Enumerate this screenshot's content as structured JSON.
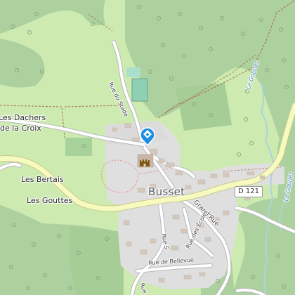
{
  "map": {
    "places": {
      "les_dachers": "Les Dachers",
      "de_la_croix": "de la Croix",
      "les_bertais": "Les Bertais",
      "les_gouttes": "Les Gouttes",
      "busset": "Busset"
    },
    "roads": {
      "rue_du_stade": "Rue du Stade",
      "grand_rue": "Grand'Rue",
      "rue_des_ecoles": "Rue des Écoles",
      "rue_de_bellevue": "Rue de Bellevue",
      "rue_bottom": "Rue S",
      "d121": "D 121",
      "rue_bottom2": "Rue"
    },
    "water": {
      "le_gourlet": "Le Gourlet",
      "le_gourlet_2": "Le Gourlet"
    },
    "pois": [
      {
        "icon": "tourist-info-icon",
        "color": "#1e8fe0"
      },
      {
        "icon": "castle-icon",
        "color": "#7a5a12"
      }
    ],
    "colors": {
      "forest": "#add19e",
      "meadow": "#cdebb0",
      "residential": "#e0dfdf",
      "road": "#ffffff",
      "casing": "#b8b8b8",
      "major_road": "#f7fabf",
      "major_casing": "#c9c98a",
      "water": "#aad3df",
      "boundary": "#a0522d"
    }
  }
}
